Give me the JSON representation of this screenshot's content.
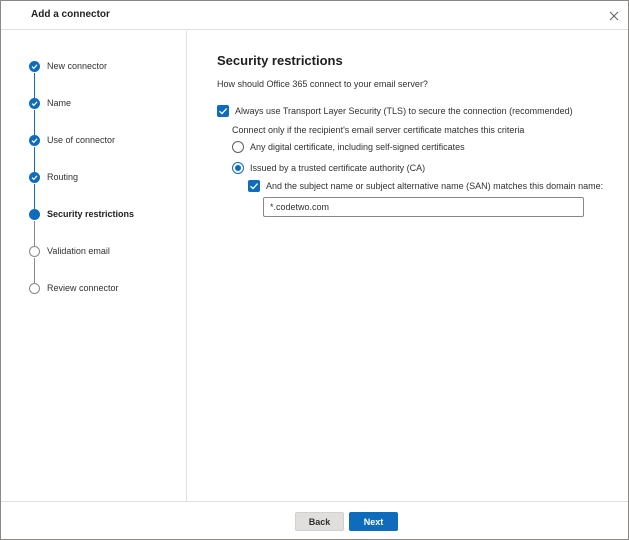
{
  "dialog": {
    "title": "Add a connector",
    "close_icon": "close-icon"
  },
  "steps": [
    {
      "label": "New connector",
      "status": "done"
    },
    {
      "label": "Name",
      "status": "done"
    },
    {
      "label": "Use of connector",
      "status": "done"
    },
    {
      "label": "Routing",
      "status": "done"
    },
    {
      "label": "Security restrictions",
      "status": "current"
    },
    {
      "label": "Validation email",
      "status": "todo"
    },
    {
      "label": "Review connector",
      "status": "todo"
    }
  ],
  "content": {
    "heading": "Security restrictions",
    "question": "How should Office 365 connect to your email server?",
    "tls_checkbox": {
      "label": "Always use Transport Layer Security (TLS) to secure the connection (recommended)",
      "checked": true
    },
    "criteria_text": "Connect only if the recipient's email server certificate matches this criteria",
    "radio_options": [
      {
        "label": "Any digital certificate, including self-signed certificates",
        "checked": false
      },
      {
        "label": "Issued by a trusted certificate authority (CA)",
        "checked": true
      }
    ],
    "san_checkbox": {
      "label": "And the subject name or subject alternative name (SAN) matches this domain name:",
      "checked": true
    },
    "domain_input": {
      "value": "*.codetwo.com"
    }
  },
  "footer": {
    "back_label": "Back",
    "next_label": "Next"
  },
  "colors": {
    "accent": "#0f6cbd",
    "inactive_step": "#8a8886",
    "border": "#e1dfdd"
  }
}
